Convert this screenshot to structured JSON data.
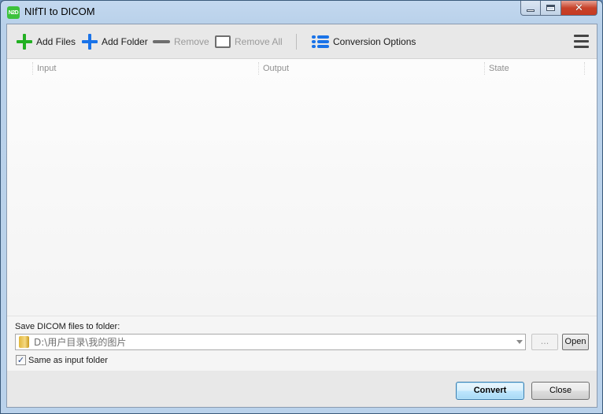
{
  "window": {
    "title": "NIfTI to DICOM",
    "app_icon_text": "N2D",
    "caption_buttons": {
      "minimize": "minimize",
      "maximize": "maximize",
      "close": "✕"
    }
  },
  "toolbar": {
    "add_files": "Add Files",
    "add_folder": "Add Folder",
    "remove": "Remove",
    "remove_all": "Remove All",
    "conversion_options": "Conversion Options",
    "colors": {
      "add_files_icon": "#22b022",
      "add_folder_icon": "#1a73e8",
      "list_icon": "#1a73e8"
    }
  },
  "grid": {
    "columns": [
      "Input",
      "Output",
      "State"
    ],
    "rows": []
  },
  "output": {
    "save_label": "Save DICOM files to folder:",
    "path_value": "D:\\用户目录\\我的图片",
    "browse_label": "...",
    "open_label": "Open",
    "same_as_input_label": "Same as input folder",
    "same_as_input_checked": true,
    "checkmark": "✓"
  },
  "footer": {
    "convert_label": "Convert",
    "close_label": "Close"
  }
}
